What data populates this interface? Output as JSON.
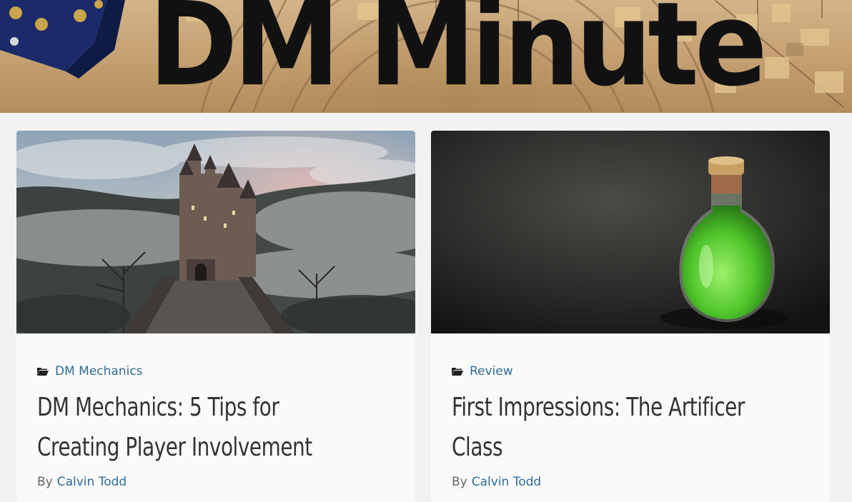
{
  "site": {
    "title": "DM Minute"
  },
  "posts": [
    {
      "category": "DM Mechanics",
      "title": "DM Mechanics: 5 Tips for Creating Player Involvement",
      "by_label": "By",
      "author": "Calvin Todd",
      "image": "castle-in-fog"
    },
    {
      "category": "Review",
      "title": "First Impressions: The Artificer Class",
      "by_label": "By",
      "author": "Calvin Todd",
      "image": "green-potion-bottle"
    }
  ],
  "colors": {
    "link": "#2f6c99",
    "title": "#333333",
    "background": "#f2f2f2",
    "card": "#fafafa"
  }
}
